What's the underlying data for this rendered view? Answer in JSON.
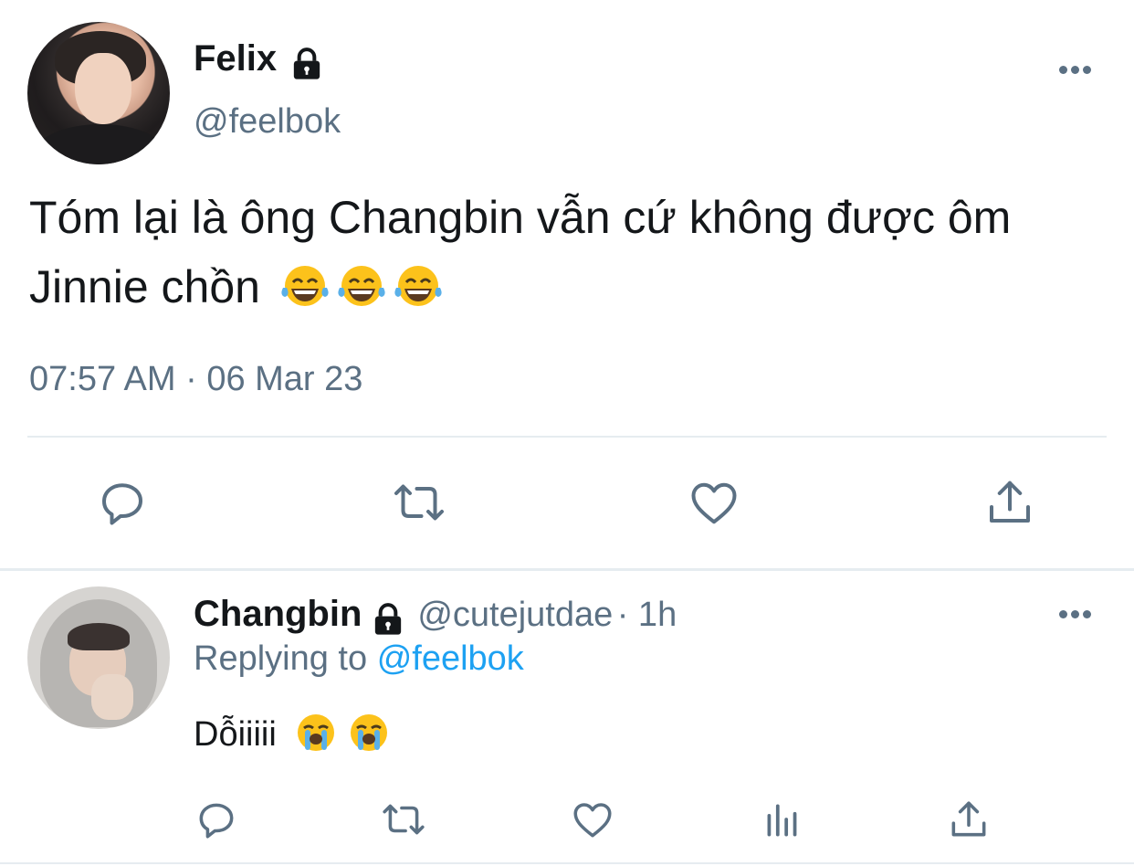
{
  "tweet": {
    "display_name": "Felix",
    "handle": "@feelbok",
    "text": "Tóm lại là ông Changbin vẫn cứ không được ôm Jinnie chồn",
    "emojis": [
      "😂",
      "😂",
      "😂"
    ],
    "timestamp": "07:57 AM · 06 Mar 23"
  },
  "reply": {
    "display_name": "Changbin",
    "handle": "@cutejutdae",
    "time": "· 1h",
    "replying_prefix": "Replying to",
    "replying_to": "@feelbok",
    "text": "Dỗiiiii",
    "emojis": [
      "😭",
      "😭"
    ]
  },
  "colors": {
    "text": "#14171a",
    "secondary": "#5b7083",
    "link": "#1da1f2",
    "divider": "#e6ecf0"
  },
  "icons": {
    "main_actions": [
      "reply-icon",
      "retweet-icon",
      "like-icon",
      "share-icon"
    ],
    "reply_actions": [
      "reply-icon",
      "retweet-icon",
      "like-icon",
      "analytics-icon",
      "share-icon"
    ]
  }
}
